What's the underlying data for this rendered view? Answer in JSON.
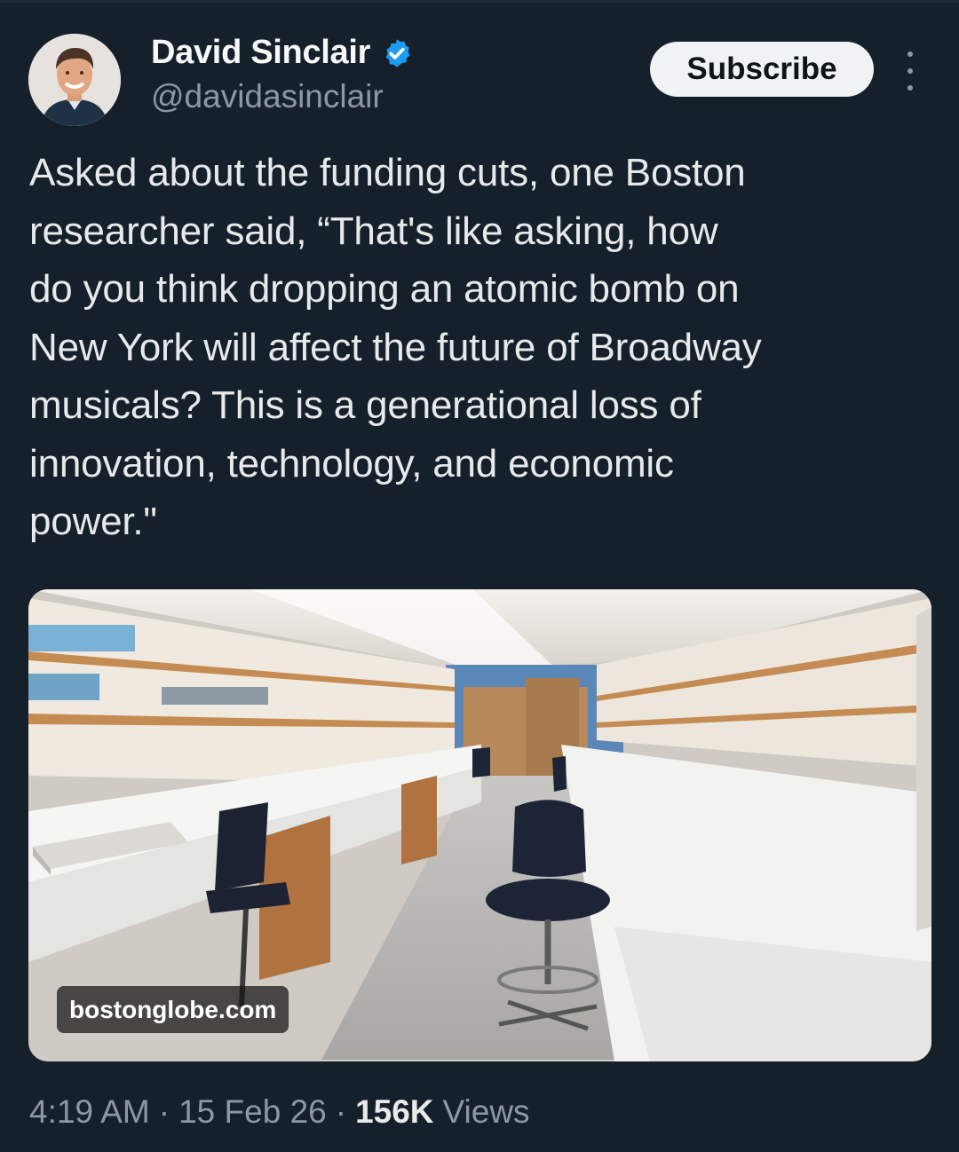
{
  "author": {
    "name": "David Sinclair",
    "handle": "@davidasinclair",
    "verified": true
  },
  "actions": {
    "subscribe_label": "Subscribe",
    "more_icon": "more-vertical-icon"
  },
  "tweet": {
    "lines": [
      "Asked about the funding cuts, one Boston",
      "researcher said, “That's like asking, how",
      "do you think dropping an atomic bomb on",
      "New York will affect the future of Broadway",
      "musicals? This is a generational loss of",
      "innovation, technology, and economic",
      "power.\""
    ]
  },
  "media": {
    "source_label": "bostonglobe.com",
    "subject": "empty laboratory photo"
  },
  "meta": {
    "time": "4:19 AM",
    "separator": "·",
    "date": "15 Feb 26",
    "views_count": "156K",
    "views_label": "Views"
  },
  "colors": {
    "background": "#15202b",
    "text": "#e7e9ea",
    "muted": "#8b98a5",
    "verified": "#1d9bf0",
    "button_bg": "#eff3f4"
  }
}
